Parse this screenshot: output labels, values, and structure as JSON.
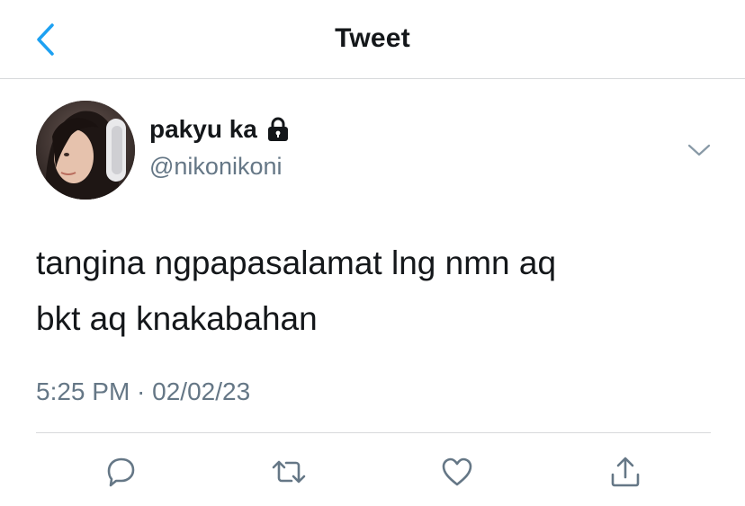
{
  "header": {
    "title": "Tweet",
    "back_icon": "chevron-left-icon"
  },
  "author": {
    "display_name": "pakyu ka",
    "handle": "@nikonikoni",
    "protected_icon": "lock-icon",
    "avatar": "profile-photo"
  },
  "tweet": {
    "text": "tangina ngpapasalamat lng nmn aq\nbkt aq knakabahan",
    "timestamp": "5:25 PM · 02/02/23"
  },
  "actions": [
    {
      "icon": "reply-icon"
    },
    {
      "icon": "retweet-icon"
    },
    {
      "icon": "like-icon"
    },
    {
      "icon": "share-icon"
    }
  ],
  "colors": {
    "accent": "#1da1f2",
    "text": "#14171a",
    "secondary_text": "#657786",
    "divider": "#d7d9db"
  }
}
